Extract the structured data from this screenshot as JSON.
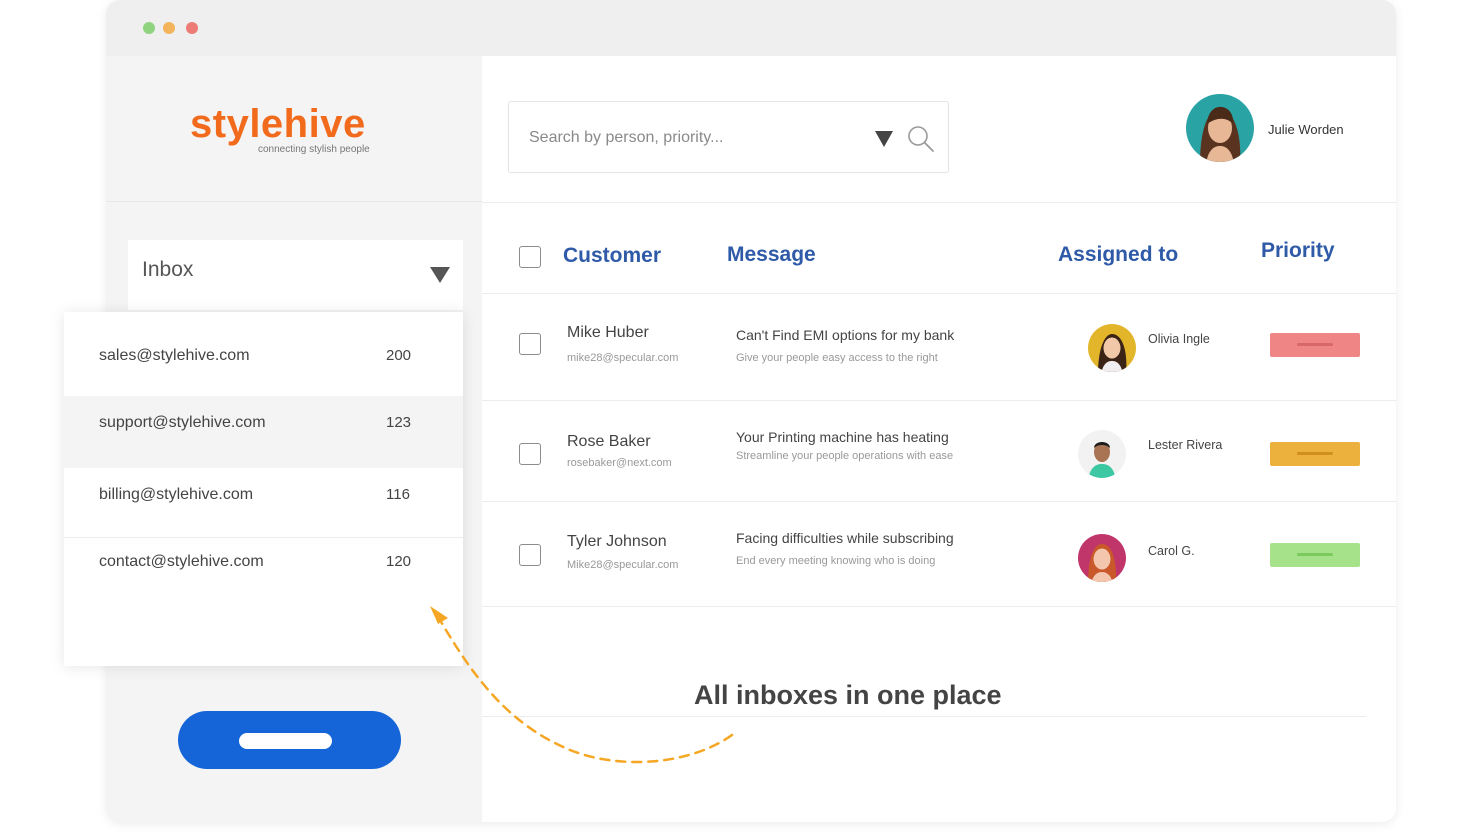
{
  "window": {
    "traffic_lights": [
      "green",
      "yellow",
      "red"
    ]
  },
  "brand": {
    "name": "stylehive",
    "tagline": "connecting stylish people",
    "color": "#f26a1b"
  },
  "sidebar": {
    "inbox_label": "Inbox",
    "cta_color": "#1565d8"
  },
  "inbox_list": [
    {
      "address": "sales@stylehive.com",
      "count": "200"
    },
    {
      "address": "support@stylehive.com",
      "count": "123"
    },
    {
      "address": "billing@stylehive.com",
      "count": "116"
    },
    {
      "address": "contact@stylehive.com",
      "count": "120"
    }
  ],
  "search": {
    "placeholder": "Search by person, priority..."
  },
  "user": {
    "name": "Julie Worden"
  },
  "table": {
    "headers": {
      "customer": "Customer",
      "message": "Message",
      "assigned": "Assigned to",
      "priority": "Priority"
    },
    "header_color": "#2e5aa8",
    "rows": [
      {
        "customer_name": "Mike Huber",
        "customer_email": "mike28@specular.com",
        "message_title": "Can't Find EMI options for my bank",
        "message_sub": "Give your people easy access to the right",
        "assignee": "Olivia Ingle",
        "priority_color": "#f08585"
      },
      {
        "customer_name": "Rose Baker",
        "customer_email": "rosebaker@next.com",
        "message_title": "Your Printing machine has heating",
        "message_sub": "Streamline your people operations with ease",
        "assignee": "Lester Rivera",
        "priority_color": "#ecb03d"
      },
      {
        "customer_name": "Tyler Johnson",
        "customer_email": "Mike28@specular.com",
        "message_title": "Facing difficulties while subscribing",
        "message_sub": "End every meeting knowing who is doing",
        "assignee": "Carol G.",
        "priority_color": "#a6e28a"
      }
    ]
  },
  "caption": "All inboxes in one place",
  "accent_arrow_color": "#f5a623"
}
